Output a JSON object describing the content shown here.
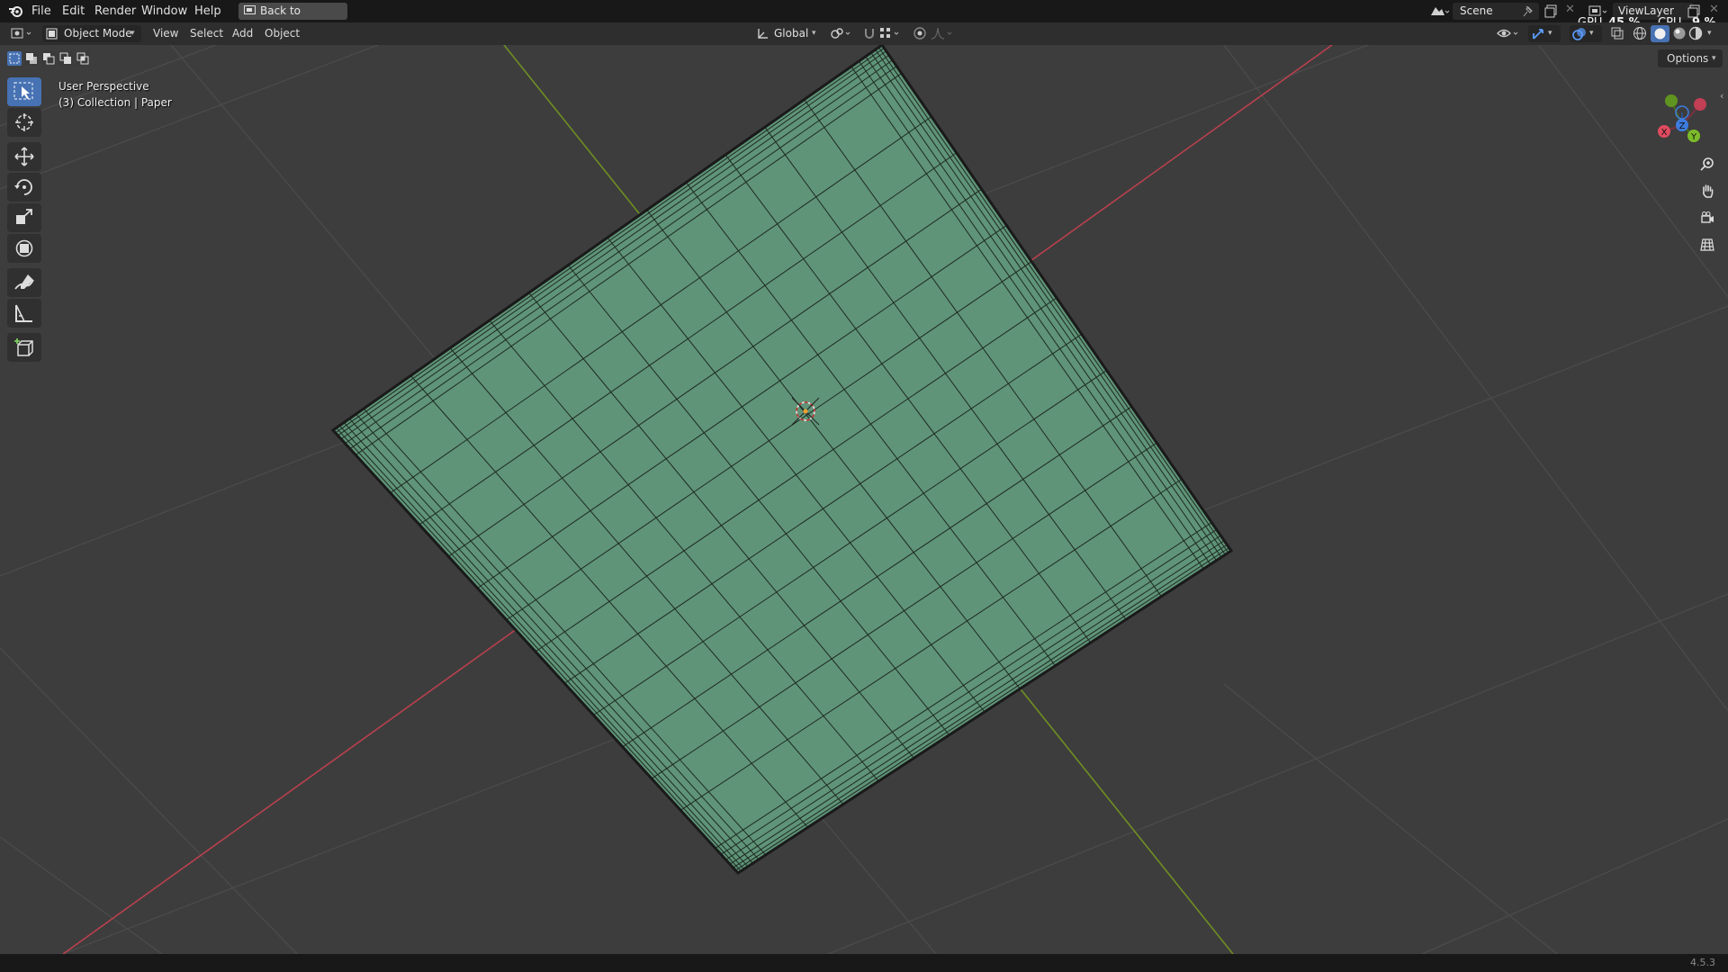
{
  "menubar": {
    "items": [
      "File",
      "Edit",
      "Render",
      "Window",
      "Help"
    ],
    "back_button": "Back to Previous",
    "scene": "Scene",
    "view_layer": "ViewLayer",
    "gpu_label": "GPU",
    "gpu_value": "45 %",
    "cpu_label": "CPU",
    "cpu_value": "9 %"
  },
  "viewport_header": {
    "mode": "Object Mode",
    "menus": [
      "View",
      "Select",
      "Add",
      "Object"
    ],
    "transform_orientation": "Global"
  },
  "overlay": {
    "perspective": "User Perspective",
    "collection": "(3) Collection | Paper"
  },
  "gizmo": {
    "x_label": "X",
    "y_label": "Y",
    "z_label": "Z",
    "x_color": "#e04b5f",
    "y_color": "#7cbc2a",
    "z_color": "#3d7de0"
  },
  "options_label": "Options",
  "version": "4.5.3",
  "colors": {
    "background": "#3d3d3d",
    "mesh_fill": "#5f9478",
    "x_axis": "#c8404f",
    "y_axis": "#7a9c22",
    "accent": "#4772b3"
  },
  "tools": [
    "select-box",
    "cursor",
    "move",
    "rotate",
    "scale",
    "transform",
    "annotate",
    "measure",
    "add-cube"
  ]
}
